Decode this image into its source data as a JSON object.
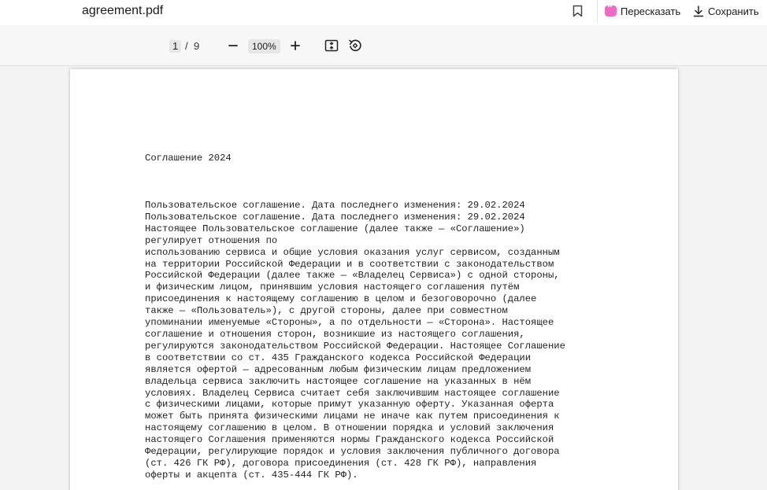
{
  "titlebar": {
    "filename": "agreement.pdf",
    "bookmark_icon": "bookmark-icon",
    "retell_label": "Пересказать",
    "save_label": "Сохранить",
    "accent_color": "#f06cc3"
  },
  "toolbar": {
    "current_page": "1",
    "page_separator": "/",
    "total_pages": "9",
    "zoom": "100%",
    "zoom_out_icon": "minus-icon",
    "zoom_in_icon": "plus-icon",
    "fit_icon": "fit-page-icon",
    "rotate_icon": "rotate-icon"
  },
  "document": {
    "title": "Соглашение 2024",
    "lines": [
      "Пользовательское соглашение. Дата последнего изменения: 29.02.2024",
      "Пользовательское соглашение. Дата последнего изменения: 29.02.2024",
      "Настоящее Пользовательское соглашение (далее также — «Соглашение»)",
      "регулирует отношения по",
      "использованию сервиса и общие условия оказания услуг сервисом, созданным",
      "на территории Российской Федерации и в соответствии с законодательством",
      "Российской Федерации (далее также — «Владелец Сервиса») с одной стороны,",
      "и физическим лицом, принявшим условия настоящего соглашения путём",
      "присоединения к настоящему соглашению в целом и безоговорочно (далее",
      "также — «Пользователь»), с другой стороны, далее при совместном",
      "упоминании именуемые «Стороны», а по отдельности — «Сторона». Настоящее",
      "соглашение и отношения сторон, возникшие из настоящего соглашения,",
      "регулируются законодательством Российской Федерации. Настоящее Соглашение",
      "в соответствии со ст. 435 Гражданского кодекса Российской Федерации",
      "является офертой — адресованным любым физическим лицам предложением",
      "владельца сервиса заключить настоящее соглашение на указанных в нём",
      "условиях. Владелец Сервиса считает себя заключившим настоящее соглашение",
      "с физическими лицами, которые примут указанную оферту. Указанная оферта",
      "может быть принята физическими лицами не иначе как путем присоединения к",
      "настоящему соглашению в целом. В отношении порядка и условий заключения",
      "настоящего Соглашения применяются нормы Гражданского кодекса Российской",
      "Федерации, регулирующие порядок и условия заключения публичного договора",
      "(ст. 426 ГК РФ), договора присоединения (ст. 428 ГК РФ), направления",
      "оферты и акцепта (ст. 435-444 ГК РФ)."
    ]
  }
}
